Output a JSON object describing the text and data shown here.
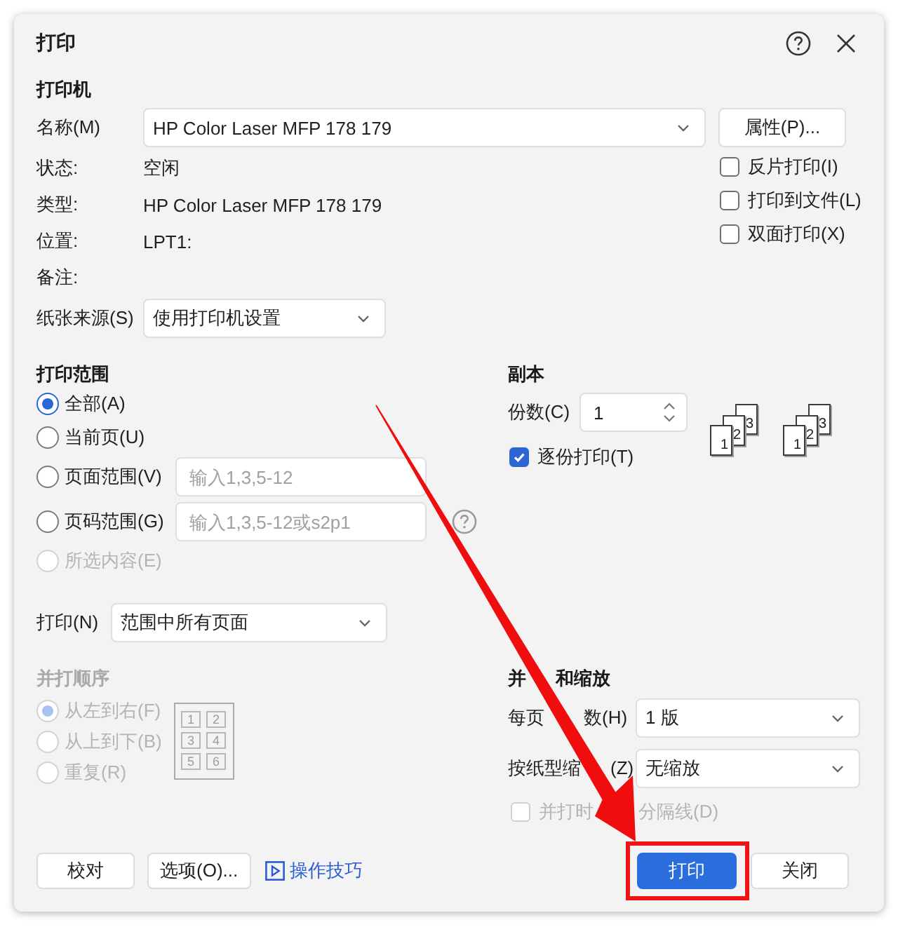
{
  "window": {
    "title": "打印"
  },
  "printer": {
    "heading": "打印机",
    "name_label": "名称(M)",
    "name_value": "HP Color Laser MFP 178 179",
    "properties_button": "属性(P)...",
    "info": [
      {
        "label": "状态:",
        "value": "空闲"
      },
      {
        "label": "类型:",
        "value": "HP Color Laser MFP 178 179"
      },
      {
        "label": "位置:",
        "value": "LPT1:"
      },
      {
        "label": "备注:"
      }
    ],
    "options": [
      {
        "label": "反片打印(I)",
        "checked": false
      },
      {
        "label": "打印到文件(L)",
        "checked": false
      },
      {
        "label": "双面打印(X)",
        "checked": false
      }
    ],
    "paper_source": {
      "label": "纸张来源(S)",
      "value": "使用打印机设置"
    }
  },
  "print_range": {
    "heading": "打印范围",
    "options": [
      {
        "kind": "plain",
        "label": "全部(A)",
        "selected": true,
        "disabled": false
      },
      {
        "kind": "plain",
        "label": "当前页(U)",
        "selected": false,
        "disabled": false
      },
      {
        "kind": "field",
        "label": "页面范围(V)",
        "placeholder": "输入1,3,5-12",
        "help": false,
        "selected": false,
        "disabled": false
      },
      {
        "kind": "field",
        "label": "页码范围(G)",
        "placeholder": "输入1,3,5-12或s2p1",
        "help": true,
        "selected": false,
        "disabled": false
      },
      {
        "kind": "plain",
        "label": "所选内容(E)",
        "selected": false,
        "disabled": true
      }
    ],
    "print_what": {
      "label": "打印(N)",
      "value": "范围中所有页面"
    }
  },
  "copies": {
    "heading": "副本",
    "count_label": "份数(C)",
    "count": "1",
    "collate": {
      "label": "逐份打印(T)",
      "checked": true
    },
    "illustrations": [
      {
        "pages": [
          "1",
          "2",
          "3"
        ]
      },
      {
        "pages": [
          "1",
          "2",
          "3"
        ]
      }
    ]
  },
  "order": {
    "heading": "并打顺序",
    "disabled": true,
    "options": [
      {
        "label": "从左到右(F)",
        "selected": true
      },
      {
        "label": "从上到下(B)",
        "selected": false
      },
      {
        "label": "重复(R)",
        "selected": false
      }
    ],
    "diagram": [
      "1",
      "2",
      "3",
      "4",
      "5",
      "6"
    ]
  },
  "scaling": {
    "heading_parts": [
      "并",
      "和缩放"
    ],
    "pages_per_sheet": {
      "label_parts": [
        "每页",
        "数(H)"
      ],
      "value": "1 版"
    },
    "scale": {
      "label_parts": [
        "按纸型缩",
        "(Z)"
      ],
      "value": "无缩放"
    },
    "separator": {
      "label_parts": [
        "并打时",
        "分隔线(D)"
      ],
      "checked": false,
      "disabled": true
    }
  },
  "buttons": [
    {
      "kind": "default",
      "label": "校对",
      "highlighted": false
    },
    {
      "kind": "default",
      "label": "选项(O)...",
      "highlighted": false
    },
    {
      "kind": "link",
      "label": "操作技巧",
      "highlighted": false
    },
    {
      "kind": "primary",
      "label": "打印",
      "highlighted": true
    },
    {
      "kind": "default",
      "label": "关闭",
      "highlighted": false
    }
  ],
  "annotation": {
    "arrow": true
  }
}
